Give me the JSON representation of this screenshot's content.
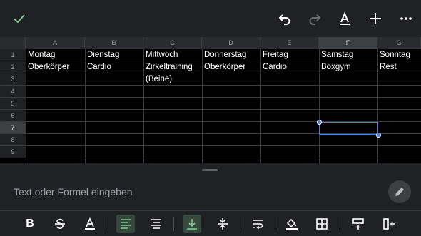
{
  "colors": {
    "accent_green": "#81c995",
    "selection_blue": "#4a7cf0"
  },
  "toolbar_top": {
    "icons": [
      "check-icon",
      "undo-icon",
      "redo-icon",
      "text-color-icon",
      "add-icon",
      "more-icon"
    ]
  },
  "sheet": {
    "columns": [
      "A",
      "B",
      "C",
      "D",
      "E",
      "F",
      "G"
    ],
    "selected_column": "F",
    "rows": [
      "1",
      "2",
      "3",
      "4",
      "5",
      "6",
      "7",
      "8",
      "9"
    ],
    "selected_row": "7",
    "cells": {
      "A1": "Montag",
      "B1": "Dienstag",
      "C1": "Mittwoch",
      "D1": "Donnerstag",
      "E1": "Freitag",
      "F1": "Samstag",
      "G1": "Sonntag",
      "A2": "Oberkörper",
      "B2": "Cardio",
      "C2": "Zirkeltraining",
      "D2": "Oberkörper",
      "E2": "Cardio",
      "F2": "Boxgym",
      "G2": "Rest",
      "C3": "(Beine)"
    },
    "selected_cell": "F7"
  },
  "formula_bar": {
    "placeholder": "Text oder Formel eingeben"
  },
  "format_toolbar": {
    "bold_label": "B",
    "tools": [
      "bold-icon",
      "strikethrough-icon",
      "text-color-icon",
      "align-left-icon",
      "align-center-icon",
      "valign-bottom-icon",
      "valign-middle-icon",
      "wrap-text-icon",
      "fill-color-icon",
      "borders-icon",
      "insert-row-icon",
      "insert-column-icon"
    ]
  }
}
